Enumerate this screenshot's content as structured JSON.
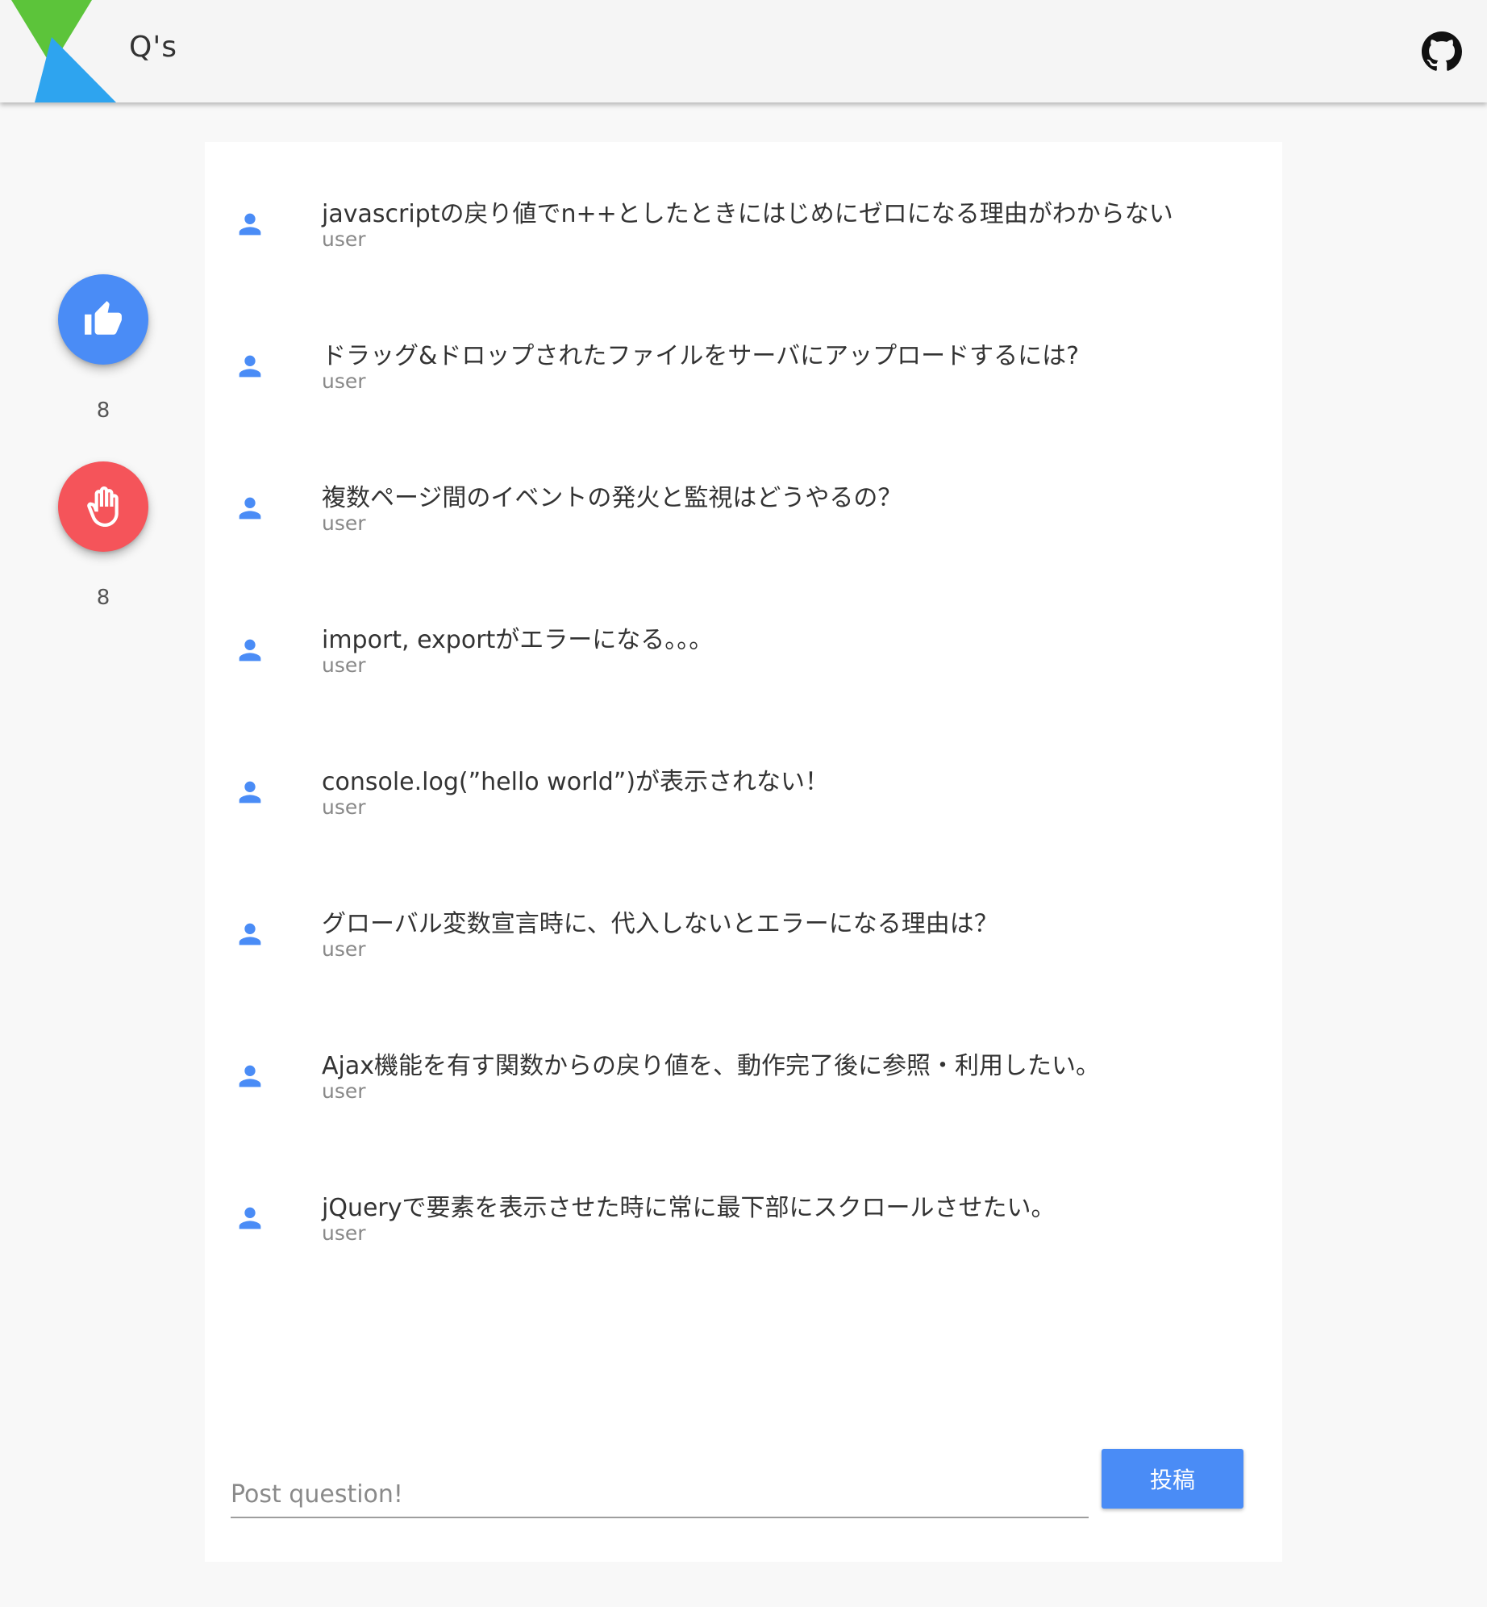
{
  "app": {
    "title": "Q's",
    "logo_colors": {
      "top": "#5cc43a",
      "bottom": "#2ea4ef"
    },
    "github_icon": "github-icon"
  },
  "sidebar": {
    "like": {
      "icon": "thumbs-up-icon",
      "color": "#4a8cf6",
      "count": "8"
    },
    "stop": {
      "icon": "raised-hand-icon",
      "color": "#f5545a",
      "count": "8"
    }
  },
  "questions": [
    {
      "title": "javascriptの戻り値でn++としたときにはじめにゼロになる理由がわからない",
      "user": "user"
    },
    {
      "title": "ドラッグ&ドロップされたファイルをサーバにアップロードするには?",
      "user": "user"
    },
    {
      "title": "複数ページ間のイベントの発火と監視はどうやるの？",
      "user": "user"
    },
    {
      "title": "import, exportがエラーになる。。。",
      "user": "user"
    },
    {
      "title": "console.log(”hello world”)が表示されない！",
      "user": "user"
    },
    {
      "title": "グローバル変数宣言時に、代入しないとエラーになる理由は？",
      "user": "user"
    },
    {
      "title": "Ajax機能を有す関数からの戻り値を、動作完了後に参照・利用したい。",
      "user": "user"
    },
    {
      "title": "jQueryで要素を表示させた時に常に最下部にスクロールさせたい。",
      "user": "user"
    }
  ],
  "post": {
    "placeholder": "Post question!",
    "value": "",
    "button_label": "投稿"
  },
  "colors": {
    "accent": "#4a8cf6",
    "danger": "#f5545a",
    "avatar": "#4a8cf6"
  }
}
